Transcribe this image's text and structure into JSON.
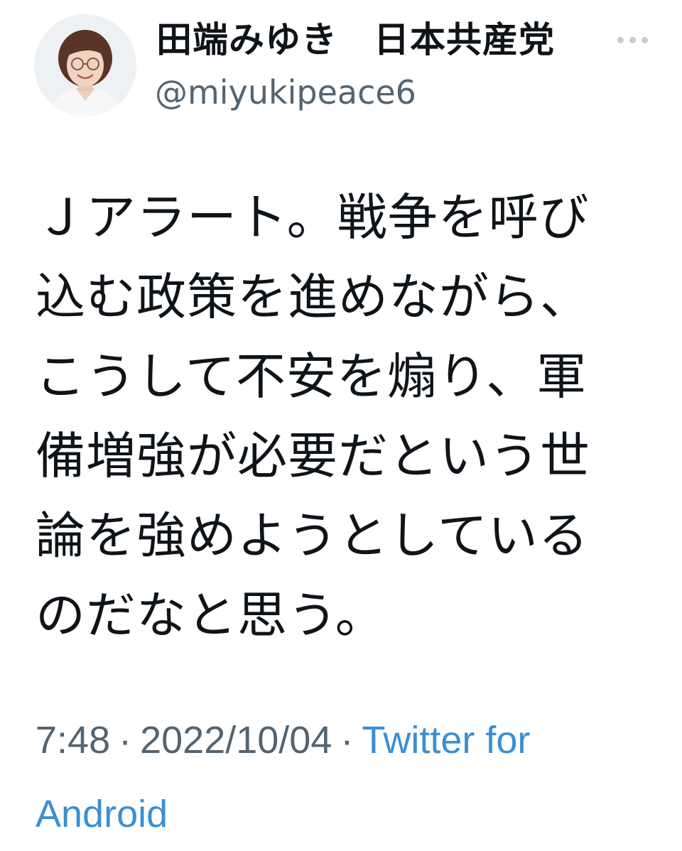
{
  "tweet": {
    "author": {
      "display_name": "田端みゆき　日本共産党",
      "handle": "@miyukipeace6"
    },
    "text_lines": [
      "Ｊアラート。戦争を呼び",
      "込む政策を進めながら、",
      "こうして不安を煽り、軍",
      "備増強が必要だという世",
      "論を強めようとしている",
      "のだなと思う。"
    ],
    "time": "7:48",
    "date": "2022/10/04",
    "source": "Twitter for Android",
    "separator": "·"
  },
  "colors": {
    "text": "#0f1419",
    "secondary": "#536471",
    "link": "#3b8fd3",
    "more_dots": "#c4cdd4"
  },
  "icons": {
    "more": "more-horizontal-icon",
    "avatar": "profile-photo"
  }
}
